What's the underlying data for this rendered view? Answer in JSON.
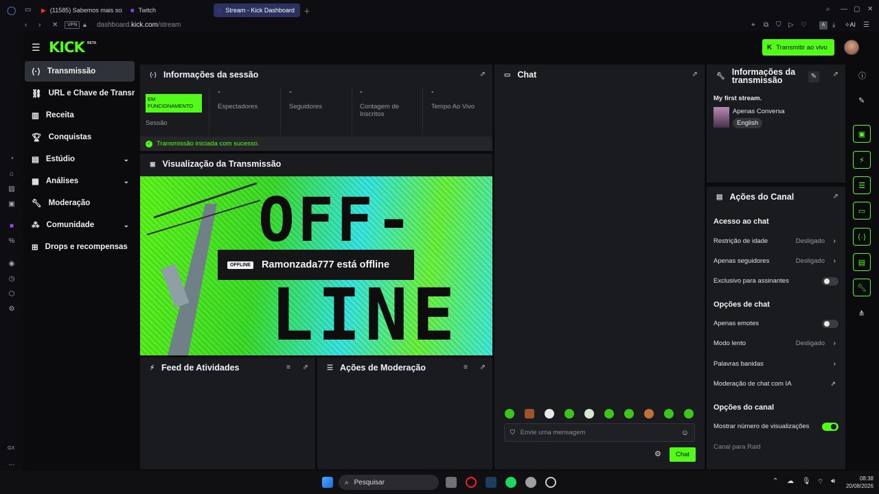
{
  "browser": {
    "tabs": [
      {
        "label": "(11585) Sabemos mais sob",
        "icon": "youtube-icon"
      },
      {
        "label": "Twitch",
        "icon": "twitch-icon"
      },
      {
        "label": "Stream - Kick Dashboard",
        "icon": "loading-icon"
      }
    ],
    "url_prefix": "dashboard.",
    "url_host": "kick.com",
    "url_path": "/stream",
    "vpn_label": "VPN",
    "ai_label": "AI",
    "ext_label": "A"
  },
  "header": {
    "logo": "KICK",
    "logo_badge": "BETA",
    "go_live_label": "Transmitir ao vivo"
  },
  "sidebar": {
    "items": [
      {
        "label": "Transmissão",
        "icon": "broadcast-icon",
        "active": true
      },
      {
        "label": "URL e Chave de Transmissão",
        "icon": "link-icon"
      },
      {
        "label": "Receita",
        "icon": "bar-chart-icon"
      },
      {
        "label": "Conquistas",
        "icon": "trophy-icon"
      },
      {
        "label": "Estúdio",
        "icon": "studio-icon",
        "expandable": true
      },
      {
        "label": "Análises",
        "icon": "analytics-icon",
        "expandable": true
      },
      {
        "label": "Moderação",
        "icon": "wrench-icon"
      },
      {
        "label": "Comunidade",
        "icon": "community-icon",
        "expandable": true
      },
      {
        "label": "Drops e recompensas",
        "icon": "gift-icon"
      }
    ]
  },
  "session": {
    "title": "Informações da sessão",
    "status_badge": "EM FUNCIONAMENTO",
    "status_caption": "Sessão",
    "stats": [
      {
        "value": "-",
        "label": "Espectadores"
      },
      {
        "value": "-",
        "label": "Seguidores"
      },
      {
        "value": "-",
        "label": "Contagem de Inscritos"
      },
      {
        "value": "-",
        "label": "Tempo Ao Vivo"
      }
    ],
    "success_message": "Transmissão iniciada com sucesso."
  },
  "preview": {
    "title": "Visualização da Transmissão",
    "offline_badge": "OFFLINE",
    "offline_text": "Ramonzada777 está offline",
    "art_top": "OFF-",
    "art_bottom": "LINE"
  },
  "activity_feed": {
    "title": "Feed de Atividades"
  },
  "mod_actions": {
    "title": "Ações de Moderação"
  },
  "chat": {
    "title": "Chat",
    "placeholder": "Envie uma mensagem",
    "send_label": "Chat"
  },
  "stream_info": {
    "title": "Informações da transmissão",
    "stream_title": "My first stream.",
    "category": "Apenas Conversa",
    "language": "English"
  },
  "channel_actions": {
    "title": "Ações do Canal",
    "chat_access": "Acesso ao chat",
    "age_restriction": {
      "label": "Restrição de idade",
      "value": "Desligado"
    },
    "followers_only": {
      "label": "Apenas seguidores",
      "value": "Desligado"
    },
    "subscribers_only": {
      "label": "Exclusivo para assinantes",
      "on": false
    },
    "chat_options": "Opções de chat",
    "emotes_only": {
      "label": "Apenas emotes",
      "on": false
    },
    "slow_mode": {
      "label": "Modo lento",
      "value": "Desligado"
    },
    "banned_words": {
      "label": "Palavras banidas"
    },
    "ai_moderation": {
      "label": "Moderação de chat com IA"
    },
    "channel_options": "Opções do canal",
    "show_viewers": {
      "label": "Mostrar número de visualizações",
      "on": true
    },
    "raid_channel": "Canal para Raid"
  },
  "taskbar": {
    "search_placeholder": "Pesquisar",
    "time": "08:38",
    "date": "20/08/2026"
  },
  "colors": {
    "accent": "#53fc18",
    "panel": "#1a1b1e",
    "background": "#0b0b0d"
  }
}
